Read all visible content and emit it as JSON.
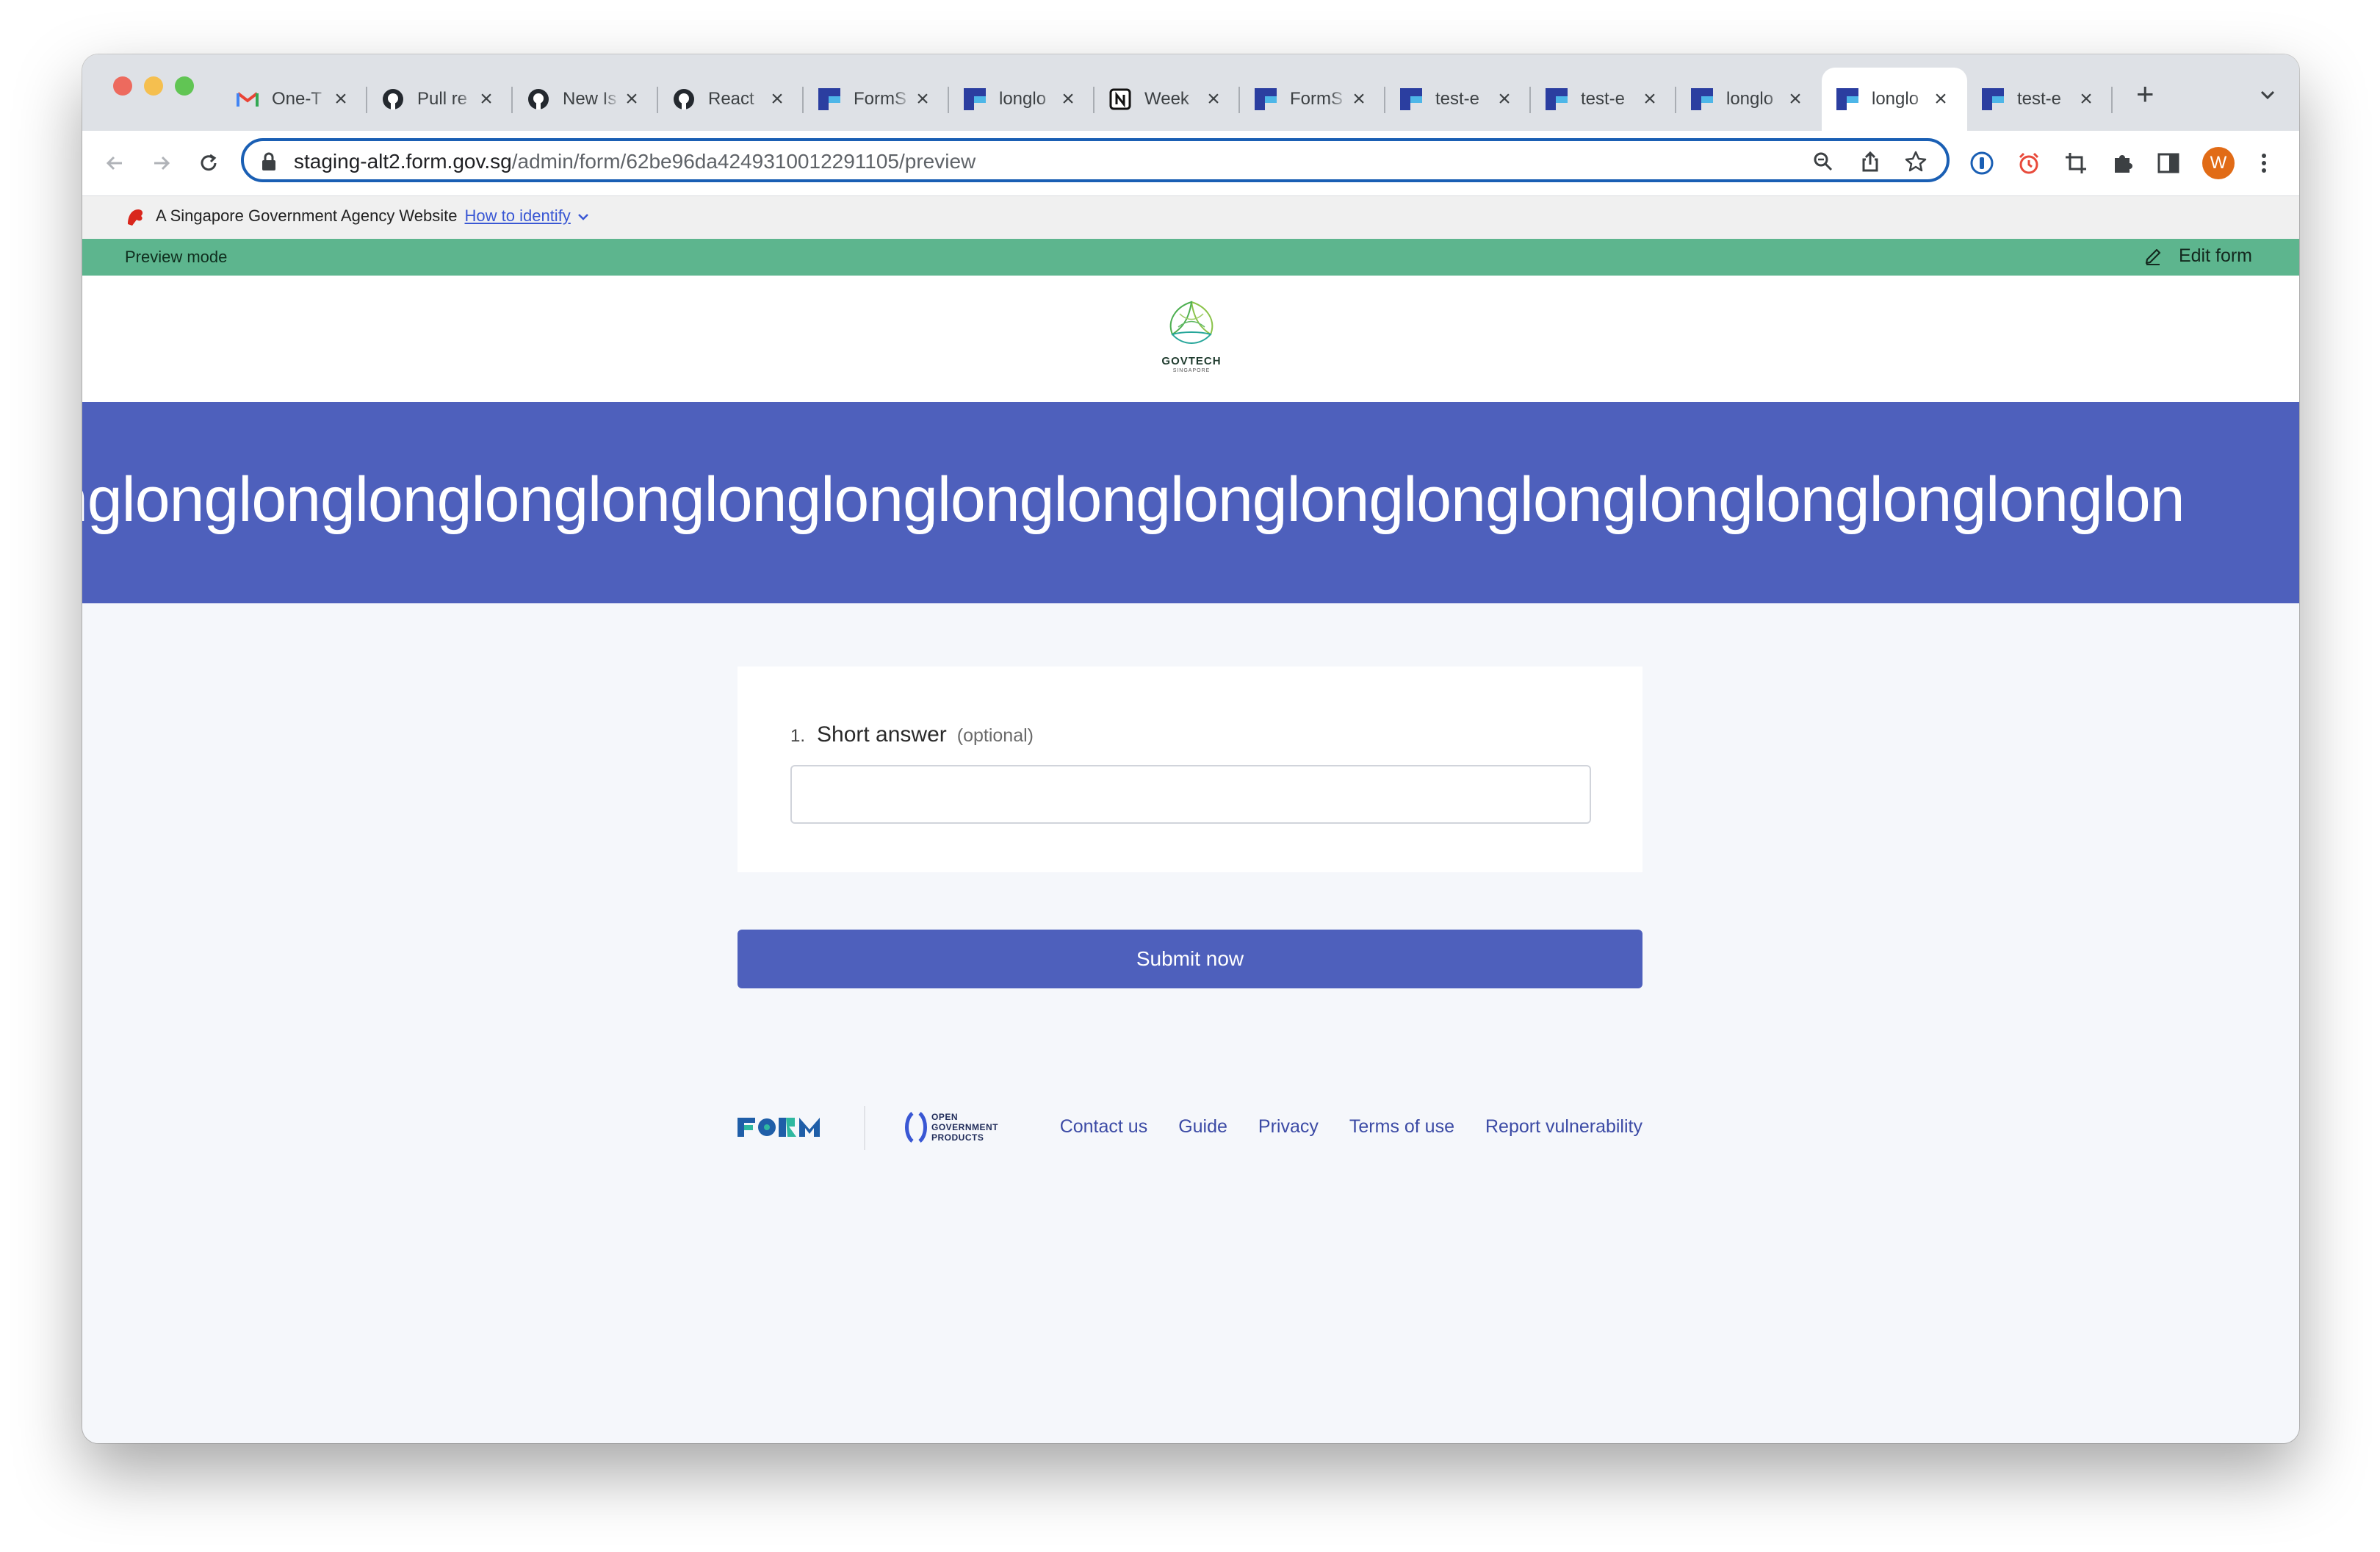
{
  "browser": {
    "tabs": [
      {
        "title": "One-T",
        "icon": "gmail-icon"
      },
      {
        "title": "Pull re",
        "icon": "github-icon"
      },
      {
        "title": "New Is",
        "icon": "github-icon"
      },
      {
        "title": "React",
        "icon": "github-icon"
      },
      {
        "title": "FormS",
        "icon": "formsg-icon"
      },
      {
        "title": "longlo",
        "icon": "formsg-icon"
      },
      {
        "title": "Week",
        "icon": "notion-icon"
      },
      {
        "title": "FormS",
        "icon": "formsg-icon"
      },
      {
        "title": "test-e",
        "icon": "formsg-icon"
      },
      {
        "title": "test-e",
        "icon": "formsg-icon"
      },
      {
        "title": "longlo",
        "icon": "formsg-icon"
      },
      {
        "title": "longlo",
        "icon": "formsg-icon",
        "active": true
      },
      {
        "title": "test-e",
        "icon": "formsg-icon"
      }
    ],
    "url_host": "staging-alt2.form.gov.sg",
    "url_path": "/admin/form/62be96da4249310012291105/preview",
    "avatar_initial": "W"
  },
  "masthead": {
    "text": "A Singapore Government Agency Website",
    "link": "How to identify"
  },
  "preview_bar": {
    "label": "Preview mode",
    "edit_label": "Edit form"
  },
  "logo": {
    "text": "GOVTECH",
    "subtext": "SINGAPORE"
  },
  "form": {
    "title": "nglonglonglonglonglonglonglonglonglonglonglonglonglonglonglonglonglonglon",
    "question": {
      "number": "1.",
      "label": "Short answer",
      "optional": "(optional)",
      "value": ""
    },
    "submit_label": "Submit now"
  },
  "footer": {
    "ogp_line1": "OPEN",
    "ogp_line2": "GOVERNMENT",
    "ogp_line3": "PRODUCTS",
    "links": [
      "Contact us",
      "Guide",
      "Privacy",
      "Terms of use",
      "Report vulnerability"
    ]
  },
  "colors": {
    "brand": "#4e60bc",
    "preview": "#5db58e",
    "omnibox_border": "#1a5fb4"
  }
}
